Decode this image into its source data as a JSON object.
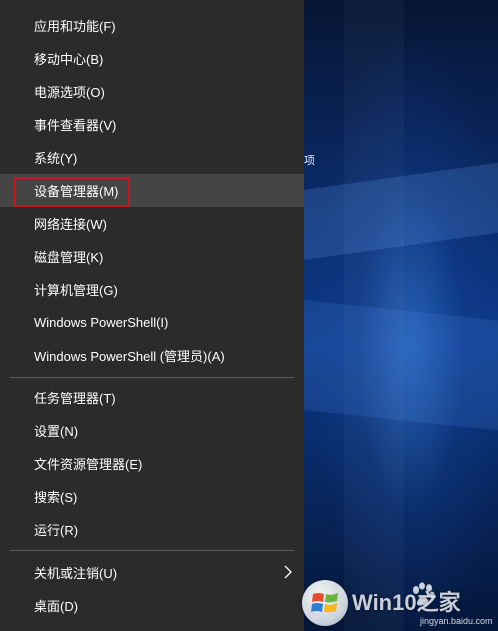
{
  "menu": {
    "items": [
      {
        "label": "应用和功能(F)"
      },
      {
        "label": "移动中心(B)"
      },
      {
        "label": "电源选项(O)"
      },
      {
        "label": "事件查看器(V)"
      },
      {
        "label": "系统(Y)"
      },
      {
        "label": "设备管理器(M)"
      },
      {
        "label": "网络连接(W)"
      },
      {
        "label": "磁盘管理(K)"
      },
      {
        "label": "计算机管理(G)"
      },
      {
        "label": "Windows PowerShell(I)"
      },
      {
        "label": "Windows PowerShell (管理员)(A)"
      },
      {
        "label": "任务管理器(T)"
      },
      {
        "label": "设置(N)"
      },
      {
        "label": "文件资源管理器(E)"
      },
      {
        "label": "搜索(S)"
      },
      {
        "label": "运行(R)"
      },
      {
        "label": "关机或注销(U)"
      },
      {
        "label": "桌面(D)"
      }
    ],
    "highlighted_index": 5,
    "highlight_color": "#c8161e"
  },
  "desktop": {
    "glyph": "项"
  },
  "watermark": {
    "text": "Win10之家",
    "sub": "jingyan.baidu.com"
  },
  "colors": {
    "menu_bg": "#2b2b2b",
    "hover_bg": "#444444",
    "desktop_blue": "#0d3a8a"
  }
}
